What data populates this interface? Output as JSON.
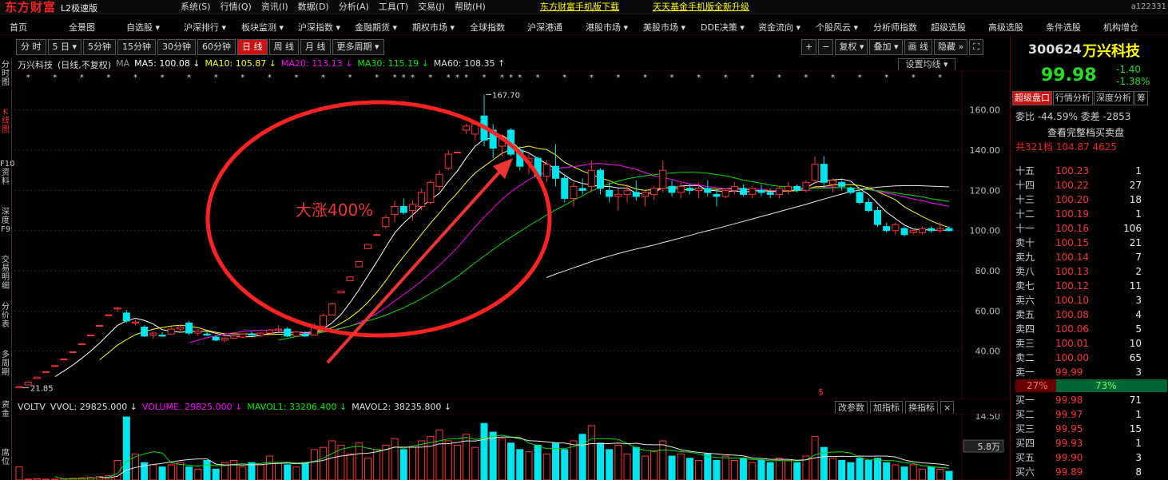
{
  "app": {
    "logo": "东方财富",
    "edition": "L2极速版",
    "user_id": "a122331"
  },
  "menu": [
    "系统(S)",
    "行情(Q)",
    "资讯(I)",
    "数据(D)",
    "分析(A)",
    "工具(T)",
    "交易(J)",
    "帮助(H)"
  ],
  "promos": [
    "东方财富手机版下载",
    "天天基金手机版全新升级"
  ],
  "nav": [
    "首页",
    "全景图",
    "自选股 ▾",
    "沪深排行 ▾",
    "板块监测 ▾",
    "沪深指数 ▾",
    "金融期货 ▾",
    "期权市场 ▾",
    "全球指数",
    "沪深港通",
    "港股市场 ▾",
    "美股市场 ▾",
    "DDE决策 ▾",
    "资金流向 ▾",
    "个股风云 ▾",
    "分析师指数",
    "超级选股",
    "高级选股",
    "条件选股",
    "机构增仓"
  ],
  "left_tabs": [
    "分时图",
    "K线图",
    "F10资料",
    "深度F9",
    "交易明细",
    "分价表",
    "多周期",
    "资金",
    "席位"
  ],
  "periods": [
    "分 时",
    "5 日 ▾",
    "5分钟",
    "15分钟",
    "30分钟",
    "60分钟",
    "日 线",
    "周 线",
    "月 线",
    "更多周期 ▾"
  ],
  "active_period": "日 线",
  "right_tools": [
    "+",
    "−",
    "复权 ▾",
    "叠加 ▾",
    "画 线",
    "隐藏 »",
    "⛶"
  ],
  "ma_legend": {
    "stock": "万兴科技",
    "mode": "(日线,不复权)",
    "ma": "MA",
    "ma5": "MA5: 100.08 ↓",
    "ma10": "MA10: 105.87 ↓",
    "ma20": "MA20: 113.13 ↓",
    "ma30": "MA30: 115.19 ↓",
    "ma60": "MA60: 108.35 ↑",
    "set_button": "设置均线 ▾"
  },
  "colors": {
    "up": "#ff3232",
    "down": "#00e5ee",
    "ma5": "#ffffff",
    "ma10": "#ffff00",
    "ma20": "#ff00ff",
    "ma30": "#00e000",
    "ma60": "#e8e8e8"
  },
  "annotation": {
    "text": "大涨400%",
    "high_label": "167.70",
    "low_label": "21.85",
    "marker": "$"
  },
  "vol_legend": {
    "name": "VOLTV",
    "vvol": "VVOL: 29825.000 ↓",
    "volume": "VOLUME: 29825.000 ↓",
    "mavol1": "MAVOL1: 33206.400 ↓",
    "mavol2": "MAVOL2: 38235.800 ↓",
    "top": "14.50",
    "unit": "5.8万"
  },
  "vol_tools": [
    "改参数",
    "加指标",
    "换指标",
    "×"
  ],
  "chart_data": {
    "type": "candlestick",
    "ylim": [
      20,
      175
    ],
    "yticks": [
      "40.00",
      "60.00",
      "80.00",
      "100.00",
      "120.00",
      "140.00",
      "160.00"
    ],
    "ohlc": [
      [
        21.85,
        22.5,
        21.85,
        22.4
      ],
      [
        23.2,
        24.6,
        23.2,
        24.6
      ],
      [
        26.4,
        27.1,
        26.4,
        27.1
      ],
      [
        29.8,
        29.8,
        29.8,
        29.8
      ],
      [
        32.8,
        32.8,
        32.8,
        32.8
      ],
      [
        36.1,
        36.1,
        36.1,
        36.1
      ],
      [
        39.7,
        39.7,
        39.7,
        39.7
      ],
      [
        43.7,
        43.7,
        43.7,
        43.7
      ],
      [
        48.0,
        48.0,
        48.0,
        48.0
      ],
      [
        52.8,
        52.8,
        52.8,
        52.8
      ],
      [
        58.1,
        58.1,
        58.1,
        58.1
      ],
      [
        61.0,
        62.0,
        59.5,
        61.5
      ],
      [
        59.0,
        60.5,
        54.0,
        55.0
      ],
      [
        54.0,
        55.5,
        53.0,
        54.5
      ],
      [
        52.0,
        53.0,
        47.0,
        47.5
      ],
      [
        48.0,
        50.0,
        46.0,
        49.0
      ],
      [
        48.0,
        49.5,
        47.0,
        47.5
      ],
      [
        48.5,
        52.0,
        48.0,
        51.0
      ],
      [
        51.0,
        53.0,
        50.0,
        52.0
      ],
      [
        54.0,
        55.0,
        48.0,
        49.0
      ],
      [
        49.0,
        51.0,
        47.5,
        50.0
      ],
      [
        48.5,
        50.0,
        47.5,
        48.0
      ],
      [
        47.0,
        48.0,
        45.0,
        45.5
      ],
      [
        45.5,
        47.0,
        44.5,
        46.5
      ],
      [
        46.5,
        48.0,
        46.0,
        47.5
      ],
      [
        47.0,
        49.0,
        46.5,
        48.5
      ],
      [
        48.5,
        50.0,
        47.5,
        48.0
      ],
      [
        48.0,
        49.5,
        47.0,
        49.0
      ],
      [
        49.0,
        51.0,
        48.0,
        50.5
      ],
      [
        50.5,
        53.0,
        49.5,
        51.0
      ],
      [
        51.0,
        52.0,
        47.0,
        47.5
      ],
      [
        47.5,
        50.0,
        47.0,
        49.5
      ],
      [
        48.5,
        50.0,
        47.0,
        47.5
      ],
      [
        48.0,
        54.0,
        48.0,
        52.5
      ],
      [
        52.5,
        58.5,
        52.5,
        57.7
      ],
      [
        58.0,
        63.5,
        58.0,
        63.5
      ],
      [
        69.0,
        69.9,
        69.0,
        69.9
      ],
      [
        75.0,
        76.9,
        75.0,
        76.9
      ],
      [
        82.0,
        84.6,
        82.0,
        84.6
      ],
      [
        91.0,
        93.1,
        91.0,
        93.1
      ],
      [
        98.0,
        98.5,
        97.5,
        98.0
      ],
      [
        102.0,
        108.0,
        101.0,
        106.5
      ],
      [
        108.0,
        115.0,
        104.0,
        112.0
      ],
      [
        112.0,
        116.0,
        108.0,
        109.0
      ],
      [
        110.0,
        115.0,
        105.0,
        113.0
      ],
      [
        112.0,
        121.0,
        110.0,
        119.0
      ],
      [
        114.0,
        125.0,
        113.0,
        124.0
      ],
      [
        122.0,
        130.0,
        120.0,
        128.0
      ],
      [
        131.0,
        140.0,
        130.0,
        138.0
      ],
      [
        139.0,
        139.0,
        139.0,
        139.0
      ],
      [
        150.0,
        153.0,
        148.0,
        152.0
      ],
      [
        148.0,
        154.0,
        145.0,
        153.0
      ],
      [
        157.0,
        167.7,
        142.0,
        145.0
      ],
      [
        150.0,
        153.0,
        136.0,
        141.0
      ],
      [
        142.0,
        148.0,
        137.0,
        146.0
      ],
      [
        150.0,
        151.0,
        137.0,
        138.0
      ],
      [
        140.0,
        142.0,
        130.0,
        132.0
      ],
      [
        134.0,
        138.0,
        128.0,
        136.0
      ],
      [
        136.0,
        137.0,
        126.0,
        127.0
      ],
      [
        127.0,
        135.0,
        124.0,
        133.0
      ],
      [
        132.0,
        143.0,
        122.0,
        126.0
      ],
      [
        126.0,
        128.0,
        114.0,
        116.0
      ],
      [
        116.0,
        124.0,
        112.0,
        122.0
      ],
      [
        121.0,
        126.0,
        118.0,
        120.0
      ],
      [
        122.0,
        135.0,
        119.0,
        130.0
      ],
      [
        130.0,
        131.0,
        118.0,
        121.0
      ],
      [
        120.0,
        124.0,
        114.0,
        117.0
      ],
      [
        117.0,
        121.0,
        110.0,
        118.0
      ],
      [
        118.0,
        123.0,
        114.0,
        120.0
      ],
      [
        119.0,
        125.0,
        115.0,
        117.0
      ],
      [
        117.0,
        120.0,
        112.0,
        119.0
      ],
      [
        118.0,
        122.0,
        115.0,
        121.0
      ],
      [
        121.0,
        135.0,
        119.0,
        130.0
      ],
      [
        122.0,
        125.0,
        117.0,
        119.0
      ],
      [
        119.0,
        124.0,
        116.0,
        122.0
      ],
      [
        121.0,
        123.0,
        118.0,
        120.0
      ],
      [
        120.0,
        124.0,
        116.0,
        121.0
      ],
      [
        121.0,
        125.0,
        117.0,
        119.0
      ],
      [
        118.0,
        121.0,
        112.0,
        117.0
      ],
      [
        117.0,
        121.0,
        116.0,
        120.0
      ],
      [
        120.0,
        124.0,
        118.0,
        122.0
      ],
      [
        121.0,
        123.0,
        117.0,
        118.0
      ],
      [
        118.0,
        122.0,
        116.0,
        121.0
      ],
      [
        120.0,
        123.0,
        117.0,
        119.0
      ],
      [
        119.0,
        121.0,
        116.0,
        118.0
      ],
      [
        118.0,
        122.0,
        116.0,
        121.0
      ],
      [
        120.0,
        124.0,
        118.0,
        122.0
      ],
      [
        122.0,
        123.0,
        119.0,
        120.0
      ],
      [
        120.0,
        125.0,
        119.0,
        124.0
      ],
      [
        125.0,
        137.0,
        123.0,
        133.0
      ],
      [
        133.0,
        137.0,
        121.0,
        124.0
      ],
      [
        123.0,
        126.0,
        119.0,
        125.0
      ],
      [
        124.0,
        125.0,
        120.0,
        122.0
      ],
      [
        121.0,
        122.0,
        118.0,
        119.0
      ],
      [
        119.0,
        120.0,
        113.0,
        114.0
      ],
      [
        114.0,
        116.0,
        109.0,
        110.0
      ],
      [
        110.0,
        112.0,
        102.0,
        103.0
      ],
      [
        102.0,
        104.0,
        99.0,
        100.0
      ],
      [
        100.0,
        104.0,
        98.0,
        103.0
      ],
      [
        101.0,
        102.0,
        97.0,
        98.0
      ],
      [
        99.0,
        101.0,
        98.0,
        100.0
      ],
      [
        99.0,
        102.0,
        98.0,
        101.0
      ],
      [
        101.0,
        102.0,
        99.0,
        100.0
      ],
      [
        100.0,
        104.0,
        99.0,
        101.0
      ],
      [
        101.0,
        102.0,
        99.5,
        99.98
      ]
    ],
    "volume_ymax": 14.5,
    "volumes": [
      3.0,
      0.2,
      0.3,
      0.2,
      0.2,
      0.3,
      0.4,
      0.5,
      0.6,
      0.8,
      1.0,
      4.5,
      14.5,
      6.0,
      4.0,
      3.5,
      3.0,
      3.5,
      4.0,
      3.0,
      2.5,
      4.5,
      2.5,
      4.0,
      4.5,
      3.0,
      4.0,
      3.5,
      5.5,
      4.0,
      3.5,
      3.0,
      4.0,
      7.0,
      7.5,
      9.0,
      8.0,
      6.0,
      8.5,
      5.0,
      7.0,
      8.0,
      9.5,
      7.0,
      7.5,
      9.0,
      10.0,
      11.5,
      9.0,
      8.0,
      10.5,
      7.5,
      13.0,
      11.0,
      9.5,
      8.5,
      7.0,
      6.5,
      8.0,
      6.0,
      8.5,
      7.0,
      9.0,
      10.5,
      12.5,
      8.5,
      7.0,
      8.0,
      6.0,
      7.5,
      5.5,
      6.5,
      9.0,
      5.5,
      6.0,
      5.0,
      4.5,
      6.0,
      4.5,
      5.5,
      4.5,
      5.0,
      4.0,
      4.5,
      4.0,
      5.0,
      4.5,
      4.0,
      5.5,
      10.0,
      7.5,
      5.0,
      4.5,
      4.0,
      5.0,
      4.5,
      5.0,
      4.0,
      3.5,
      3.0,
      3.5,
      2.5,
      3.0,
      2.5,
      2.0
    ]
  },
  "quote": {
    "code": "300624",
    "name": "万兴科技",
    "price": "99.98",
    "change": "-1.40",
    "pct": "-1.38%"
  },
  "quote_tabs": [
    "超级盘口",
    "行情分析",
    "深度分析",
    "筹"
  ],
  "weibi": "委比  -44.59% 委差  -2853",
  "full_book": "查看完整档买卖盘",
  "total": "共321档 104.87   4625",
  "asks": [
    {
      "label": "十五",
      "price": "100.23",
      "vol": "1"
    },
    {
      "label": "十四",
      "price": "100.22",
      "vol": "27"
    },
    {
      "label": "十三",
      "price": "100.20",
      "vol": "18"
    },
    {
      "label": "十二",
      "price": "100.19",
      "vol": "1"
    },
    {
      "label": "十一",
      "price": "100.16",
      "vol": "106"
    },
    {
      "label": "卖十",
      "price": "100.15",
      "vol": "21"
    },
    {
      "label": "卖九",
      "price": "100.14",
      "vol": "7"
    },
    {
      "label": "卖八",
      "price": "100.13",
      "vol": "2"
    },
    {
      "label": "卖七",
      "price": "100.12",
      "vol": "11"
    },
    {
      "label": "卖六",
      "price": "100.10",
      "vol": "3"
    },
    {
      "label": "卖五",
      "price": "100.08",
      "vol": "4"
    },
    {
      "label": "卖四",
      "price": "100.06",
      "vol": "5"
    },
    {
      "label": "卖三",
      "price": "100.01",
      "vol": "10"
    },
    {
      "label": "卖二",
      "price": "100.00",
      "vol": "65"
    },
    {
      "label": "卖一",
      "price": "99.99",
      "vol": "3"
    }
  ],
  "ratio": {
    "sell": "27%",
    "buy": "73%"
  },
  "bids": [
    {
      "label": "买一",
      "price": "99.98",
      "vol": "71"
    },
    {
      "label": "买二",
      "price": "99.97",
      "vol": "1"
    },
    {
      "label": "买三",
      "price": "99.95",
      "vol": "15"
    },
    {
      "label": "买四",
      "price": "99.93",
      "vol": "1"
    },
    {
      "label": "买五",
      "price": "99.90",
      "vol": "3"
    },
    {
      "label": "买六",
      "price": "99.89",
      "vol": "8"
    }
  ]
}
